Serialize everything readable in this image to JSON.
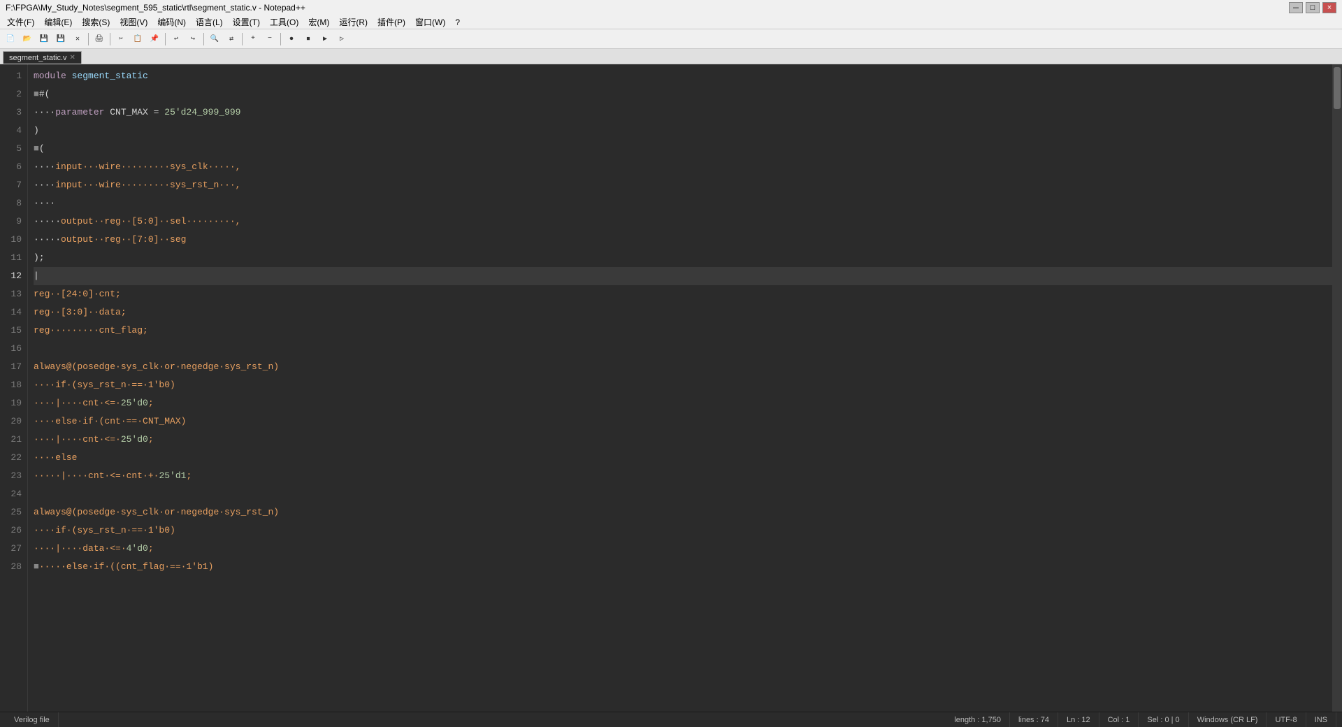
{
  "titleBar": {
    "title": "F:\\FPGA\\My_Study_Notes\\segment_595_static\\rtl\\segment_static.v - Notepad++",
    "minimize": "－",
    "maximize": "□",
    "close": "×"
  },
  "menuBar": {
    "items": [
      "文件(F)",
      "编辑(E)",
      "搜索(S)",
      "视图(V)",
      "编码(N)",
      "语言(L)",
      "设置(T)",
      "工具(O)",
      "宏(M)",
      "运行(R)",
      "插件(P)",
      "窗口(W)",
      "?"
    ]
  },
  "tab": {
    "label": "segment_static.v",
    "close": "✕"
  },
  "statusBar": {
    "fileType": "Verilog file",
    "length": "length : 1,750",
    "lines": "lines : 74",
    "ln": "Ln : 12",
    "col": "Col : 1",
    "sel": "Sel : 0 | 0",
    "lineEnding": "Windows (CR LF)",
    "encoding": "UTF-8",
    "ins": "INS"
  },
  "code": {
    "lines": [
      {
        "num": 1,
        "tokens": [
          {
            "t": "module",
            "c": "port-dir"
          },
          {
            "t": " segment_static",
            "c": "plain"
          }
        ]
      },
      {
        "num": 2,
        "tokens": [
          {
            "t": "■",
            "c": "plain"
          },
          {
            "t": "#(",
            "c": "plain"
          }
        ],
        "fold": true
      },
      {
        "num": 3,
        "tokens": [
          {
            "t": "····parameter CNT_MAX = 25'd24_999_999",
            "c": "port-dir"
          }
        ]
      },
      {
        "num": 4,
        "tokens": [
          {
            "t": ")",
            "c": "plain"
          }
        ]
      },
      {
        "num": 5,
        "tokens": [
          {
            "t": "■",
            "c": "plain"
          },
          {
            "t": "(",
            "c": "plain"
          }
        ],
        "fold": true
      },
      {
        "num": 6,
        "tokens": [
          {
            "t": "····",
            "c": "dot-txt"
          },
          {
            "t": "input",
            "c": "port-dir"
          },
          {
            "t": "···wire·········sys_clk·····,",
            "c": "port-dir"
          }
        ]
      },
      {
        "num": 7,
        "tokens": [
          {
            "t": "····",
            "c": "dot-txt"
          },
          {
            "t": "input",
            "c": "port-dir"
          },
          {
            "t": "···wire·········sys_rst_n···,",
            "c": "port-dir"
          }
        ]
      },
      {
        "num": 8,
        "tokens": [
          {
            "t": "····",
            "c": "plain"
          }
        ]
      },
      {
        "num": 9,
        "tokens": [
          {
            "t": "·····",
            "c": "dot-txt"
          },
          {
            "t": "output",
            "c": "port-dir"
          },
          {
            "t": "··reg··[5:0]··sel·········,",
            "c": "port-dir"
          }
        ]
      },
      {
        "num": 10,
        "tokens": [
          {
            "t": "·····",
            "c": "dot-txt"
          },
          {
            "t": "output",
            "c": "port-dir"
          },
          {
            "t": "··reg··[7:0]··seg",
            "c": "port-dir"
          }
        ]
      },
      {
        "num": 11,
        "tokens": [
          {
            "t": ");",
            "c": "plain"
          }
        ]
      },
      {
        "num": 12,
        "tokens": [],
        "cursor": true
      },
      {
        "num": 13,
        "tokens": [
          {
            "t": "reg··[24:0]·cnt;",
            "c": "port-dir"
          }
        ]
      },
      {
        "num": 14,
        "tokens": [
          {
            "t": "reg··[3:0]··data;",
            "c": "port-dir"
          }
        ]
      },
      {
        "num": 15,
        "tokens": [
          {
            "t": "reg·········cnt_flag;",
            "c": "port-dir"
          }
        ]
      },
      {
        "num": 16,
        "tokens": []
      },
      {
        "num": 17,
        "tokens": [
          {
            "t": "always@(posedge·sys_clk·or·negedge·sys_rst_n)",
            "c": "port-dir"
          }
        ]
      },
      {
        "num": 18,
        "tokens": [
          {
            "t": "····if·(sys_rst_n·==·1'b0)",
            "c": "port-dir"
          }
        ]
      },
      {
        "num": 19,
        "tokens": [
          {
            "t": "····|····cnt·<=·25'd0;",
            "c": "port-dir"
          }
        ]
      },
      {
        "num": 20,
        "tokens": [
          {
            "t": "····else·if·(cnt·==·CNT_MAX)",
            "c": "port-dir"
          }
        ]
      },
      {
        "num": 21,
        "tokens": [
          {
            "t": "····|····cnt·<=·25'd0;",
            "c": "port-dir"
          }
        ]
      },
      {
        "num": 22,
        "tokens": [
          {
            "t": "····else",
            "c": "port-dir"
          }
        ]
      },
      {
        "num": 23,
        "tokens": [
          {
            "t": "·····|····cnt·<=·cnt·+·25'd1;",
            "c": "port-dir"
          }
        ]
      },
      {
        "num": 24,
        "tokens": []
      },
      {
        "num": 25,
        "tokens": [
          {
            "t": "always@(posedge·sys_clk·or·negedge·sys_rst_n)",
            "c": "port-dir"
          }
        ]
      },
      {
        "num": 26,
        "tokens": [
          {
            "t": "····if·(sys_rst_n·==·1'b0)",
            "c": "port-dir"
          }
        ]
      },
      {
        "num": 27,
        "tokens": [
          {
            "t": "····|····data·<=·4'd0;",
            "c": "port-dir"
          }
        ]
      },
      {
        "num": 28,
        "tokens": [
          {
            "t": "■·····else·if·((cnt_flag·==·1'b1)",
            "c": "port-dir"
          }
        ],
        "fold": true
      }
    ]
  }
}
